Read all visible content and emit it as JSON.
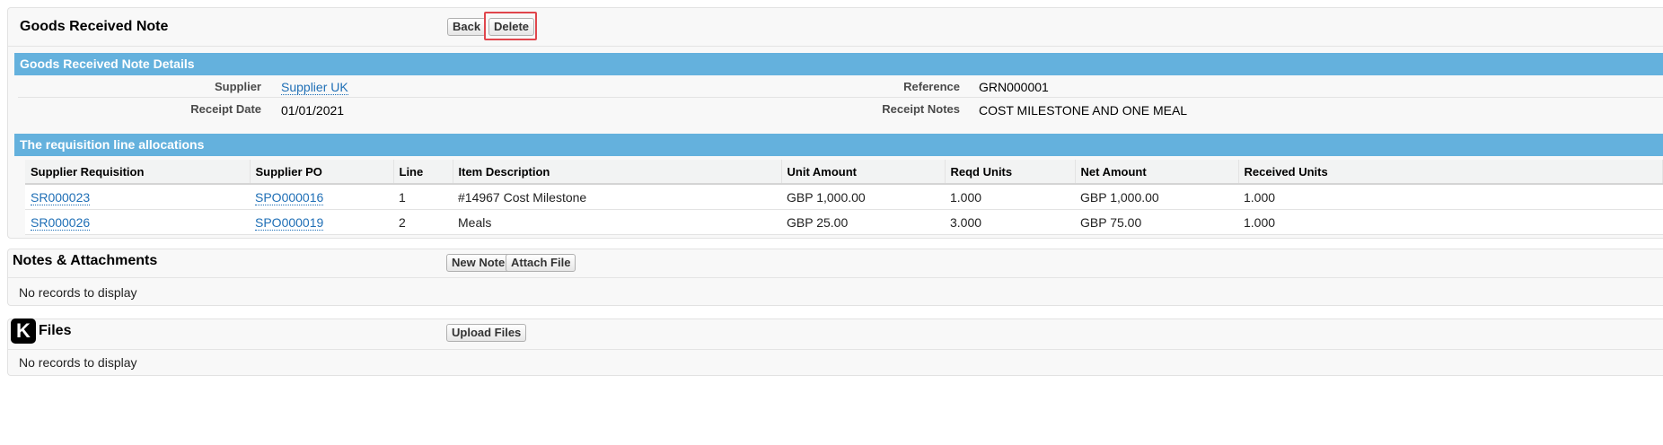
{
  "header": {
    "title": "Goods Received Note",
    "back_label": "Back",
    "delete_label": "Delete"
  },
  "details": {
    "section_title": "Goods Received Note Details",
    "supplier_label": "Supplier",
    "supplier_value": "Supplier UK",
    "reference_label": "Reference",
    "reference_value": "GRN000001",
    "receipt_date_label": "Receipt Date",
    "receipt_date_value": "01/01/2021",
    "receipt_notes_label": "Receipt Notes",
    "receipt_notes_value": "COST MILESTONE AND ONE MEAL"
  },
  "allocations": {
    "section_title": "The requisition line allocations",
    "columns": [
      "Supplier Requisition",
      "Supplier PO",
      "Line",
      "Item Description",
      "Unit Amount",
      "Reqd Units",
      "Net Amount",
      "Received Units"
    ],
    "rows": [
      [
        "SR000023",
        "SPO000016",
        "1",
        "#14967 Cost Milestone",
        "GBP 1,000.00",
        "1.000",
        "GBP 1,000.00",
        "1.000"
      ],
      [
        "SR000026",
        "SPO000019",
        "2",
        "Meals",
        "GBP 25.00",
        "3.000",
        "GBP 75.00",
        "1.000"
      ]
    ]
  },
  "notes": {
    "title": "Notes & Attachments",
    "new_note_label": "New Note",
    "attach_file_label": "Attach File",
    "empty_text": "No records to display"
  },
  "files": {
    "icon_letter": "K",
    "title": "Files",
    "upload_label": "Upload Files",
    "empty_text": "No records to display"
  },
  "colors": {
    "section_bar": "#64b1dd",
    "link": "#1f6fb6",
    "highlight": "#e0464c"
  }
}
